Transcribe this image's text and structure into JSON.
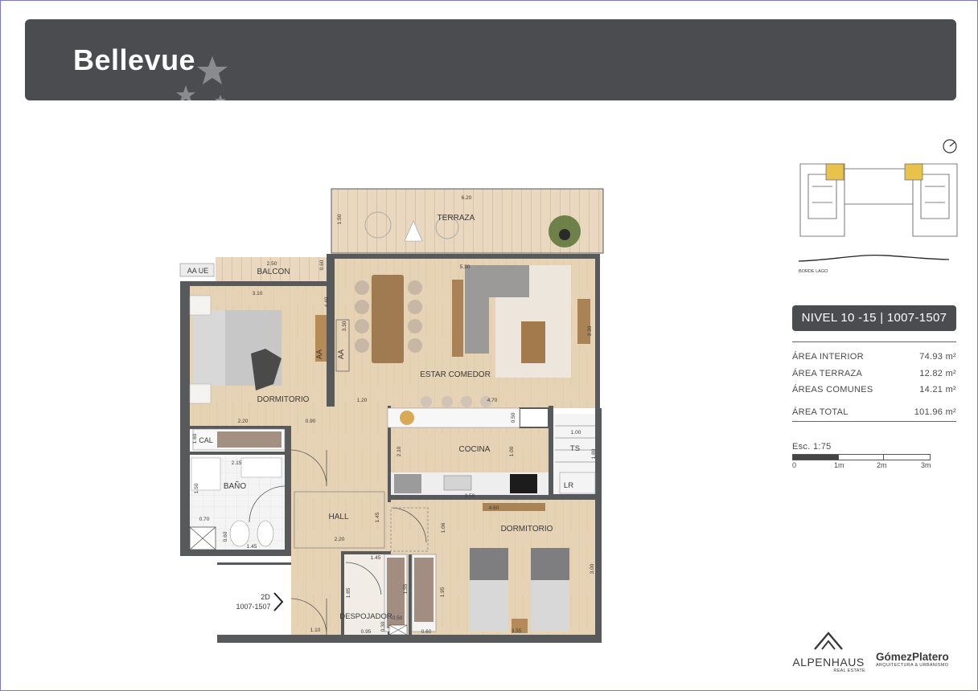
{
  "header": {
    "logo_text": "Bellevue"
  },
  "plan": {
    "rooms": {
      "terraza": "TERRAZA",
      "balcon": "BALCON",
      "estar_comedor": "ESTAR COMEDOR",
      "dormitorio_1": "DORMITORIO",
      "dormitorio_2": "DORMITORIO",
      "cocina": "COCINA",
      "bano": "BAÑO",
      "hall": "HALL",
      "despojador": "DESPOJADOR",
      "cal": "CAL",
      "ts": "TS",
      "lr": "LR",
      "aa_ue": "AA UE",
      "aa1": "AA",
      "aa2": "AA"
    },
    "dimensions": {
      "d_620": "6.20",
      "d_150a": "1.50",
      "d_250": "2.50",
      "d_060a": "0.60",
      "d_310": "3.10",
      "d_440": "4.40",
      "d_530": "5.30",
      "d_330": "3.30",
      "d_330b": "3.30",
      "d_120": "1.20",
      "d_470": "4.70",
      "d_220a": "2.20",
      "d_090": "0.90",
      "d_050a": "0.50",
      "d_100a": "1.00",
      "d_160": "1.60",
      "d_210": "2.10",
      "d_100b": "1.00",
      "d_180": "1.80",
      "d_215": "2.15",
      "d_150b": "1.50",
      "d_350": "3.50",
      "d_460": "4.60",
      "d_145a": "1.45",
      "d_220b": "2.20",
      "d_070": "0.70",
      "d_060b": "0.60",
      "d_145b": "1.45",
      "d_106": "1.06",
      "d_300": "3.00",
      "d_145c": "1.45",
      "d_185": "1.85",
      "d_155": "1.55",
      "d_195": "1.95",
      "d_030": "0.30",
      "d_050b": "0.50",
      "d_095": "0.95",
      "d_060c": "0.60",
      "d_110": "1.10",
      "d_355": "3.55"
    },
    "unit_marker": {
      "line1": "2D",
      "line2": "1007-1507"
    }
  },
  "key_plan": {
    "caption": "BORDE LAGO"
  },
  "level_label": "NIVEL 10 -15 | 1007-1507",
  "areas": [
    {
      "label": "ÁREA INTERIOR",
      "value": "74.93 m²"
    },
    {
      "label": "ÁREA TERRAZA",
      "value": "12.82 m²"
    },
    {
      "label": "ÁREAS COMUNES",
      "value": "14.21 m²"
    }
  ],
  "area_total": {
    "label": "ÁREA TOTAL",
    "value": "101.96 m²"
  },
  "scale": {
    "title": "Esc. 1:75",
    "ticks": [
      "0",
      "1m",
      "2m",
      "3m"
    ]
  },
  "brands": {
    "alpenhaus_name": "ALPENHAUS",
    "alpenhaus_sub": "REAL ESTATE",
    "gomez_name": "GómezPlatero",
    "gomez_sub": "ARQUITECTURA & URBANISMO"
  },
  "colors": {
    "header_bg": "#4b4c4f",
    "wood_floor": "#e4cfb0",
    "wall": "#58595b",
    "highlight_unit": "#e8c24a"
  }
}
